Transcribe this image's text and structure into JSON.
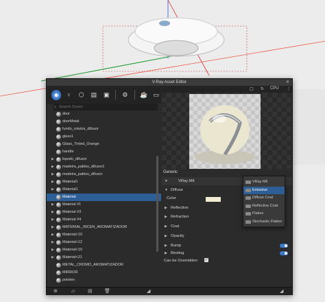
{
  "window": {
    "title": "V-Ray Asset Editor",
    "render_mode": "CPU"
  },
  "toolbar": {
    "icons": [
      "materials-icon",
      "lights-icon",
      "geometry-icon",
      "textures-icon",
      "render-elements-icon",
      "settings-icon",
      "teapot-icon",
      "render-window-icon"
    ]
  },
  "search": {
    "placeholder": "Search Scene"
  },
  "materials": [
    {
      "label": "door",
      "expandable": false,
      "selected": false
    },
    {
      "label": "doorMetal",
      "expandable": false,
      "selected": false
    },
    {
      "label": "fundo_rotulos_difusor",
      "expandable": false,
      "selected": false
    },
    {
      "label": "glass1",
      "expandable": false,
      "selected": false
    },
    {
      "label": "Glass_Tinted_Orange",
      "expandable": false,
      "selected": false
    },
    {
      "label": "handle",
      "expandable": false,
      "selected": false
    },
    {
      "label": "liquido_difusor",
      "expandable": true,
      "selected": false
    },
    {
      "label": "madeira_palitos_difusor1",
      "expandable": true,
      "selected": false
    },
    {
      "label": "madeira_palitos_difusor",
      "expandable": true,
      "selected": false
    },
    {
      "label": "Material1",
      "expandable": true,
      "selected": false
    },
    {
      "label": "Material1",
      "expandable": true,
      "selected": false
    },
    {
      "label": "Material",
      "expandable": false,
      "selected": true
    },
    {
      "label": "Material #1",
      "expandable": true,
      "selected": false
    },
    {
      "label": "Material #3",
      "expandable": true,
      "selected": false
    },
    {
      "label": "Material #4",
      "expandable": true,
      "selected": false
    },
    {
      "label": "MATERIAL_INCEN_AROMATIZADOR",
      "expandable": true,
      "selected": false
    },
    {
      "label": "Material<10",
      "expandable": true,
      "selected": false
    },
    {
      "label": "Material<12",
      "expandable": true,
      "selected": false
    },
    {
      "label": "Material<19",
      "expandable": true,
      "selected": false
    },
    {
      "label": "Material<21",
      "expandable": true,
      "selected": false
    },
    {
      "label": "METAL_CROMO_AROMATIZADOR",
      "expandable": false,
      "selected": false
    },
    {
      "label": "MIRROR",
      "expandable": false,
      "selected": false
    },
    {
      "label": "poloten",
      "expandable": false,
      "selected": false
    }
  ],
  "properties": {
    "tab": "Generic",
    "material_type": "VRay Mtl",
    "sections": [
      {
        "label": "Diffuse",
        "expanded": true,
        "toggle": false
      },
      {
        "label": "Color",
        "sub": true,
        "swatch_color": "#f1ecd2"
      },
      {
        "label": "Reflection",
        "expanded": false,
        "toggle": false
      },
      {
        "label": "Refraction",
        "expanded": false,
        "toggle": false
      },
      {
        "label": "Coat",
        "expanded": false,
        "toggle": false
      },
      {
        "label": "Opacity",
        "expanded": false,
        "toggle": false
      },
      {
        "label": "Bump",
        "expanded": false,
        "toggle": true
      },
      {
        "label": "Binding",
        "expanded": false,
        "toggle": true
      }
    ],
    "override_label": "Can be Overridden",
    "override_checked": true
  },
  "layer_menu": {
    "items": [
      {
        "label": "VRay Mtl",
        "selected": false
      },
      {
        "label": "Emissive",
        "selected": true
      },
      {
        "label": "Diffuse Coat",
        "selected": false
      },
      {
        "label": "Reflective Coat",
        "selected": false
      },
      {
        "label": "Flakes",
        "selected": false
      },
      {
        "label": "Stochastic Flakes",
        "selected": false
      }
    ]
  },
  "colors": {
    "accent": "#3a78c9",
    "selection": "#2d5f96",
    "panel": "#2b2b2c"
  }
}
